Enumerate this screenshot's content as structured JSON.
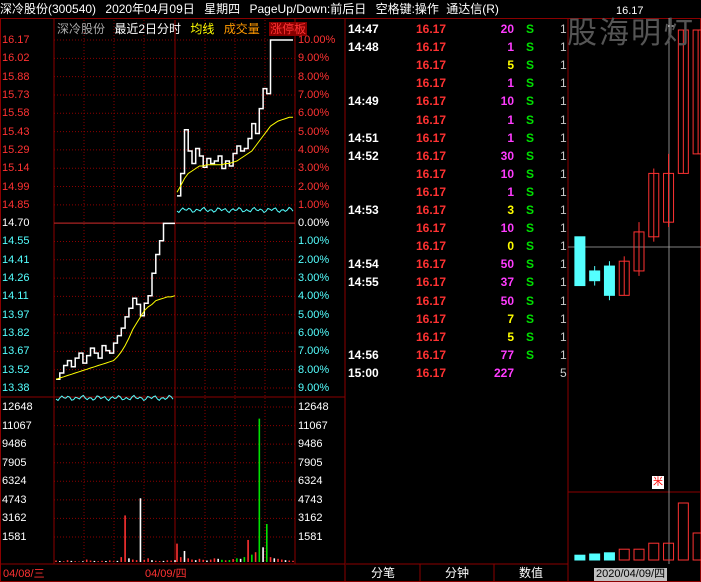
{
  "header": {
    "stock": "深冷股份(300540)",
    "date": "2020年04月09日",
    "weekday": "星期四",
    "hint": "PageUp/Down:前后日",
    "keys": "空格键:操作",
    "brand": "通达信(R)"
  },
  "chart_header": {
    "name": "深冷股份",
    "mode": "最近2日分时",
    "avg_label": "均线",
    "vol_label": "成交量",
    "flag_label": "涨停板"
  },
  "price_axis": {
    "left": [
      "16.17",
      "16.02",
      "15.88",
      "15.73",
      "15.58",
      "15.43",
      "15.29",
      "15.14",
      "14.99",
      "14.85",
      "14.70",
      "14.55",
      "14.41",
      "14.26",
      "14.11",
      "13.97",
      "13.82",
      "13.67",
      "13.52",
      "13.38"
    ],
    "right": [
      "10.00%",
      "9.00%",
      "8.00%",
      "7.00%",
      "6.00%",
      "5.00%",
      "4.00%",
      "3.00%",
      "2.00%",
      "1.00%",
      "0.00%",
      "1.00%",
      "2.00%",
      "3.00%",
      "4.00%",
      "5.00%",
      "6.00%",
      "7.00%",
      "8.00%",
      "9.00%"
    ]
  },
  "volume_axis": [
    "12648",
    "11067",
    "9486",
    "7905",
    "6324",
    "4743",
    "3162",
    "1581"
  ],
  "date_axis": [
    "04/08/三",
    "04/09/四"
  ],
  "colors": {
    "up": "#ff3232",
    "down": "#54ffff",
    "flat": "#ffffff",
    "avg": "#ffff00",
    "grid": "#8b0000",
    "vol": "#ff00ff",
    "green": "#00e000"
  },
  "ticks": [
    {
      "time": "14:47",
      "price": "16.17",
      "vol": "20",
      "bs": "S",
      "n": "1"
    },
    {
      "time": "14:48",
      "price": "16.17",
      "vol": "1",
      "bs": "S",
      "n": "1"
    },
    {
      "time": "",
      "price": "16.17",
      "vol": "5",
      "bs": "S",
      "n": "1"
    },
    {
      "time": "",
      "price": "16.17",
      "vol": "1",
      "bs": "S",
      "n": "1"
    },
    {
      "time": "14:49",
      "price": "16.17",
      "vol": "10",
      "bs": "S",
      "n": "1"
    },
    {
      "time": "",
      "price": "16.17",
      "vol": "1",
      "bs": "S",
      "n": "1"
    },
    {
      "time": "14:51",
      "price": "16.17",
      "vol": "1",
      "bs": "S",
      "n": "1"
    },
    {
      "time": "14:52",
      "price": "16.17",
      "vol": "30",
      "bs": "S",
      "n": "1"
    },
    {
      "time": "",
      "price": "16.17",
      "vol": "10",
      "bs": "S",
      "n": "1"
    },
    {
      "time": "",
      "price": "16.17",
      "vol": "1",
      "bs": "S",
      "n": "1"
    },
    {
      "time": "14:53",
      "price": "16.17",
      "vol": "3",
      "bs": "S",
      "n": "1"
    },
    {
      "time": "",
      "price": "16.17",
      "vol": "10",
      "bs": "S",
      "n": "1"
    },
    {
      "time": "",
      "price": "16.17",
      "vol": "0",
      "bs": "S",
      "n": "1"
    },
    {
      "time": "14:54",
      "price": "16.17",
      "vol": "50",
      "bs": "S",
      "n": "1"
    },
    {
      "time": "14:55",
      "price": "16.17",
      "vol": "37",
      "bs": "S",
      "n": "1"
    },
    {
      "time": "",
      "price": "16.17",
      "vol": "50",
      "bs": "S",
      "n": "1"
    },
    {
      "time": "",
      "price": "16.17",
      "vol": "7",
      "bs": "S",
      "n": "1"
    },
    {
      "time": "",
      "price": "16.17",
      "vol": "5",
      "bs": "S",
      "n": "1"
    },
    {
      "time": "14:56",
      "price": "16.17",
      "vol": "77",
      "bs": "S",
      "n": "1"
    },
    {
      "time": "15:00",
      "price": "16.17",
      "vol": "227",
      "bs": "",
      "n": "5"
    }
  ],
  "tabs": [
    "分笔",
    "分钟",
    "数值"
  ],
  "kline": {
    "high_label": "16.17",
    "watermark": "股海明灯",
    "marker": "米",
    "date": "2020/04/09/四"
  },
  "chart_data": [
    {
      "type": "line",
      "title": "最近2日分时",
      "days": [
        "04/08",
        "04/09"
      ],
      "prev_close": 14.7,
      "ylim": [
        13.38,
        16.17
      ],
      "series": [
        {
          "name": "price",
          "values": [
            13.45,
            13.5,
            13.56,
            13.6,
            13.55,
            13.62,
            13.66,
            13.58,
            13.64,
            13.7,
            13.66,
            13.62,
            13.72,
            13.68,
            13.66,
            13.74,
            13.8,
            13.86,
            13.95,
            14.02,
            14.1,
            14.05,
            13.96,
            14.06,
            14.12,
            14.3,
            14.45,
            14.56,
            14.7,
            14.7,
            14.7,
            14.7,
            14.92,
            15.1,
            15.45,
            15.28,
            15.18,
            15.3,
            15.24,
            15.15,
            15.22,
            15.18,
            15.2,
            15.24,
            15.14,
            15.2,
            15.16,
            15.26,
            15.32,
            15.28,
            15.3,
            15.38,
            15.5,
            15.42,
            15.62,
            15.78,
            15.74,
            16.17,
            16.17,
            16.17,
            16.17,
            16.17,
            16.17,
            16.17
          ]
        },
        {
          "name": "均线",
          "values": [
            13.45,
            13.46,
            13.47,
            13.48,
            13.49,
            13.5,
            13.51,
            13.52,
            13.53,
            13.54,
            13.55,
            13.56,
            13.57,
            13.58,
            13.59,
            13.6,
            13.63,
            13.67,
            13.72,
            13.78,
            13.85,
            13.9,
            13.95,
            14.0,
            14.03,
            14.05,
            14.08,
            14.09,
            14.1,
            14.11,
            14.11,
            14.12,
            14.95,
            15.0,
            15.06,
            15.1,
            15.12,
            15.14,
            15.16,
            15.16,
            15.17,
            15.17,
            15.17,
            15.17,
            15.17,
            15.18,
            15.18,
            15.19,
            15.2,
            15.22,
            15.24,
            15.26,
            15.28,
            15.32,
            15.36,
            15.4,
            15.44,
            15.48,
            15.5,
            15.52,
            15.53,
            15.54,
            15.55,
            15.55
          ]
        }
      ],
      "ratio_series": {
        "values_day1": [
          0.46,
          0.47,
          0.46,
          0.47,
          0.46,
          0.47,
          0.47,
          0.46
        ],
        "values_day2": [
          0.55,
          0.56,
          0.55,
          0.56,
          0.55,
          0.56,
          0.56,
          0.55
        ]
      }
    },
    {
      "type": "bar",
      "title": "成交量",
      "ylim": [
        0,
        12648
      ],
      "values": [
        120,
        80,
        60,
        150,
        90,
        70,
        40,
        60,
        200,
        120,
        90,
        60,
        100,
        80,
        130,
        60,
        90,
        400,
        3800,
        300,
        200,
        150,
        5200,
        180,
        300,
        150,
        100,
        80,
        90,
        140,
        120,
        150,
        1500,
        400,
        900,
        300,
        200,
        150,
        260,
        180,
        120,
        200,
        300,
        260,
        180,
        140,
        160,
        240,
        300,
        260,
        400,
        1800,
        600,
        800,
        11700,
        1200,
        3100,
        400,
        300,
        260,
        200,
        150,
        120,
        100
      ]
    },
    {
      "type": "candlestick",
      "ylim": [
        12.5,
        16.17
      ],
      "candles": [
        {
          "o": 14.05,
          "c": 13.55,
          "h": 14.05,
          "l": 13.55
        },
        {
          "o": 13.7,
          "c": 13.6,
          "h": 13.75,
          "l": 13.55
        },
        {
          "o": 13.75,
          "c": 13.45,
          "h": 13.8,
          "l": 13.4
        },
        {
          "o": 13.45,
          "c": 13.8,
          "h": 13.85,
          "l": 13.45
        },
        {
          "o": 13.7,
          "c": 14.1,
          "h": 14.2,
          "l": 13.65
        },
        {
          "o": 14.05,
          "c": 14.7,
          "h": 14.75,
          "l": 14.0
        },
        {
          "o": 14.2,
          "c": 14.7,
          "h": 14.9,
          "l": 14.15
        },
        {
          "o": 14.7,
          "c": 16.17,
          "h": 16.17,
          "l": 14.7
        },
        {
          "o": 14.9,
          "c": 16.17,
          "h": 16.17,
          "l": 14.9
        }
      ],
      "volumes": [
        0.08,
        0.1,
        0.12,
        0.18,
        0.18,
        0.28,
        0.28,
        0.95,
        0.45
      ]
    }
  ]
}
